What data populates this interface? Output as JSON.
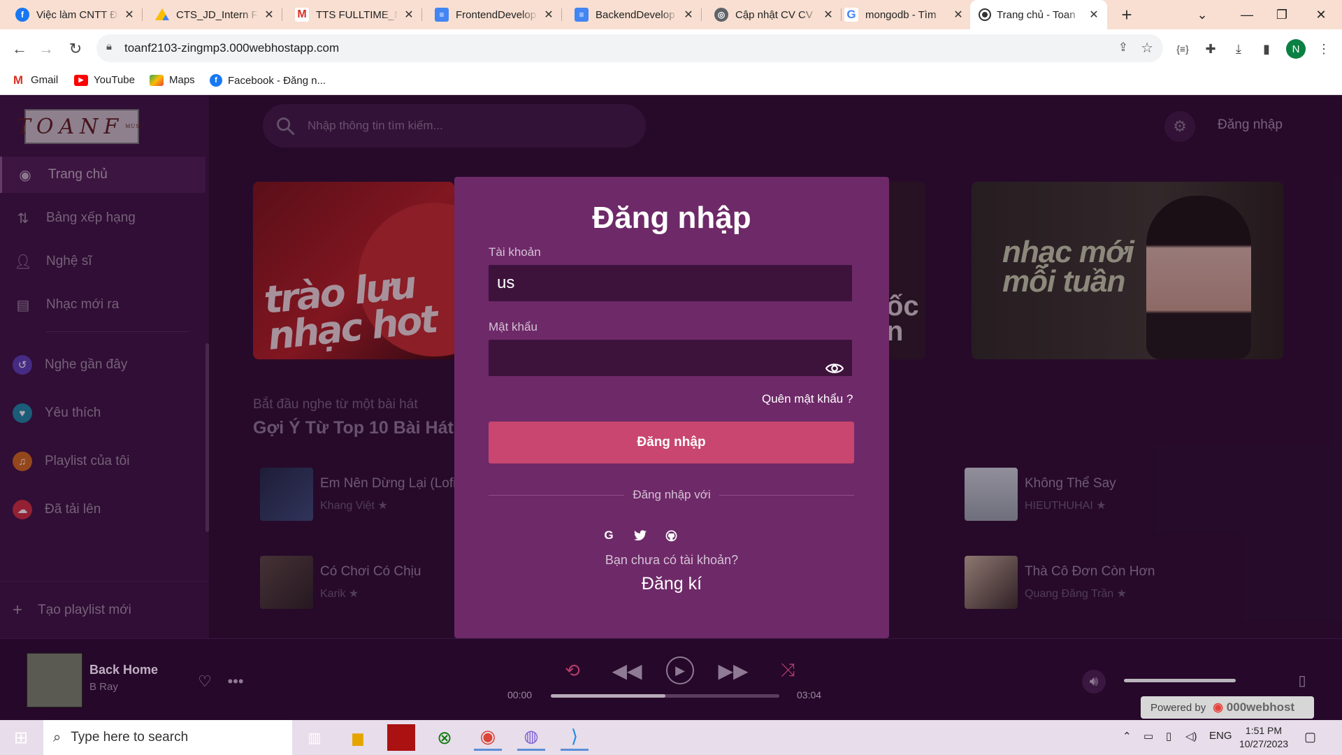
{
  "browser": {
    "tabs": [
      {
        "title": "Việc làm CNTT Đà",
        "favicon": "facebook-icon",
        "color": "#1877f2"
      },
      {
        "title": "CTS_JD_Intern Fu",
        "favicon": "google-drive-icon",
        "color": "#fbbc04"
      },
      {
        "title": "TTS FULLTIME_N",
        "favicon": "gmail-icon",
        "color": "#d93025"
      },
      {
        "title": "FrontendDevelop",
        "favicon": "google-docs-icon",
        "color": "#4285f4"
      },
      {
        "title": "BackendDevelop",
        "favicon": "google-docs-icon",
        "color": "#4285f4"
      },
      {
        "title": "Cập nhật CV CV",
        "favicon": "globe-icon",
        "color": "#5f6368"
      },
      {
        "title": "mongodb - Tìm",
        "favicon": "google-icon",
        "color": "#4285f4"
      },
      {
        "title": "Trang chủ - Toan",
        "favicon": "site-icon",
        "color": "#333333",
        "active": true
      }
    ],
    "url": "toanf2103-zingmp3.000webhostapp.com",
    "profile_initial": "N",
    "bookmarks": [
      {
        "label": "Gmail",
        "icon": "gmail-icon"
      },
      {
        "label": "YouTube",
        "icon": "youtube-icon"
      },
      {
        "label": "Maps",
        "icon": "maps-icon"
      },
      {
        "label": "Facebook - Đăng n...",
        "icon": "facebook-icon"
      }
    ]
  },
  "app": {
    "logo_text": "TOANF",
    "logo_sub": "MUSIC",
    "sidebar": {
      "items": [
        {
          "label": "Trang chủ",
          "icon": "home-disc-icon",
          "active": true
        },
        {
          "label": "Bảng xếp hạng",
          "icon": "ranking-icon"
        },
        {
          "label": "Nghệ sĩ",
          "icon": "artist-icon"
        },
        {
          "label": "Nhạc mới ra",
          "icon": "news-icon"
        },
        {
          "label": "Nghe gần đây",
          "icon": "history-icon",
          "color": "#5b3fb8"
        },
        {
          "label": "Yêu thích",
          "icon": "heart-icon",
          "color": "#1a8aa6"
        },
        {
          "label": "Playlist của tôi",
          "icon": "playlist-icon",
          "color": "#d46a1a"
        },
        {
          "label": "Đã tải lên",
          "icon": "upload-icon",
          "color": "#d2303d"
        }
      ],
      "new_playlist": "Tạo playlist mới"
    },
    "search_placeholder": "Nhập thông tin tìm kiếm...",
    "login_link": "Đăng nhập",
    "banners": [
      {
        "text": "trào lưu nhạc hot"
      },
      {
        "text": "ốc n"
      },
      {
        "text": "nhạc mới mỗi tuần"
      }
    ],
    "section_subtitle": "Bắt đầu nghe từ một bài hát",
    "section_title": "Gợi Ý Từ Top 10 Bài Hát",
    "songs": [
      {
        "title": "Em Nên Dừng Lại (Lofi V",
        "artist": "Khang Việt"
      },
      {
        "title": "Có Chơi Có Chịu",
        "artist": "Karik"
      },
      {
        "title": "Không Thể Say",
        "artist": "HIEUTHUHAI"
      },
      {
        "title": "Thà Cô Đơn Còn Hơn",
        "artist": "Quang Đăng Trần"
      }
    ]
  },
  "login_modal": {
    "title": "Đăng nhập",
    "username_label": "Tài khoản",
    "username_value": "us",
    "password_label": "Mật khẩu",
    "password_value": "",
    "forgot": "Quên mật khẩu ?",
    "submit": "Đăng nhập",
    "or_login_with": "Đăng nhập với",
    "social": [
      "G",
      "twitter",
      "github"
    ],
    "no_account": "Bạn chưa có tài khoản?",
    "signup": "Đăng kí"
  },
  "player": {
    "title": "Back Home",
    "artist": "B Ray",
    "time_current": "00:00",
    "time_total": "03:04",
    "progress": 0.5,
    "volume": 1.0
  },
  "hosting_badge": {
    "prefix": "Powered by",
    "brand": "000webhost"
  },
  "taskbar": {
    "search_placeholder": "Type here to search",
    "lang": "ENG",
    "time": "1:51 PM",
    "date": "10/27/2023"
  }
}
